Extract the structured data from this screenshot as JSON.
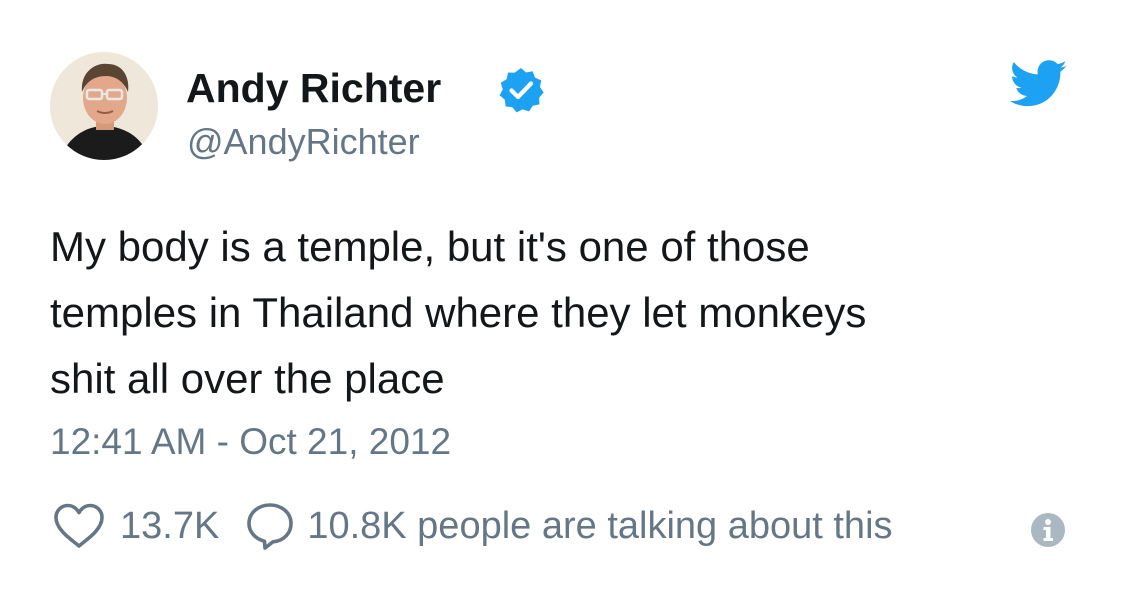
{
  "author": {
    "display_name": "Andy Richter",
    "handle": "@AndyRichter",
    "verified": true,
    "avatar_icon": "avatar-portrait"
  },
  "tweet": {
    "lines": [
      "My body is a temple, but it's one of those",
      "temples in Thailand where they let monkeys",
      "shit all over the place"
    ],
    "timestamp": "12:41 AM - Oct 21, 2012"
  },
  "actions": {
    "like_count": "13.7K",
    "talking_text": "10.8K people are talking about this"
  },
  "icons": {
    "verified": "verified-badge-icon",
    "brand": "twitter-bird-icon",
    "like": "heart-icon",
    "reply": "speech-bubble-icon",
    "info": "info-icon"
  },
  "colors": {
    "brand_blue": "#1da1f2",
    "text_primary": "#14171a",
    "text_secondary": "#657786",
    "info_gray": "#aab8c2"
  }
}
